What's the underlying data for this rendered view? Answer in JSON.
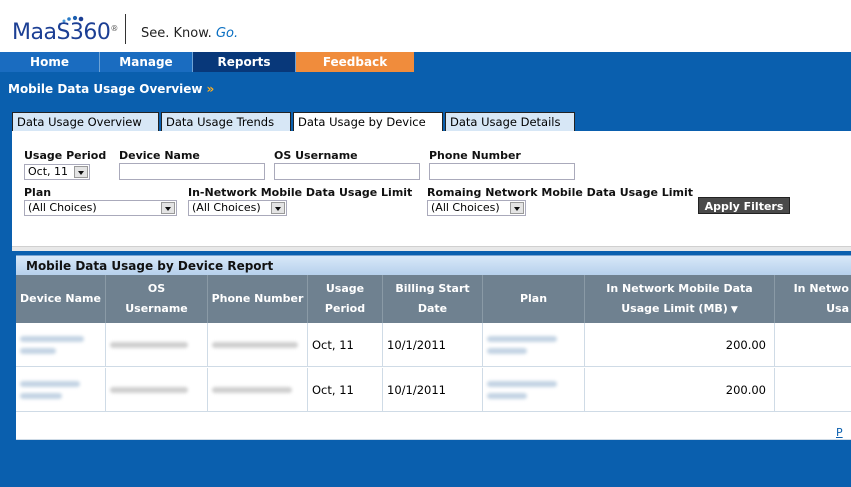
{
  "header": {
    "logo_text": "MaaS360",
    "logo_mark": "®",
    "tagline_prefix": "See. Know.",
    "tagline_go": "Go."
  },
  "nav": {
    "home": "Home",
    "manage": "Manage",
    "reports": "Reports",
    "feedback": "Feedback"
  },
  "section": {
    "title": "Mobile Data Usage Overview",
    "arrow": "»"
  },
  "tabs": [
    {
      "label": "Data Usage Overview"
    },
    {
      "label": "Data Usage Trends"
    },
    {
      "label": "Data Usage by Device"
    },
    {
      "label": "Data Usage Details"
    }
  ],
  "filters": {
    "usage_period_label": "Usage Period",
    "usage_period_value": "Oct, 11",
    "device_name_label": "Device Name",
    "device_name_value": "",
    "os_username_label": "OS Username",
    "os_username_value": "",
    "phone_number_label": "Phone Number",
    "phone_number_value": "",
    "plan_label": "Plan",
    "plan_value": "(All Choices)",
    "in_network_label": "In-Network Mobile Data Usage Limit",
    "in_network_value": "(All Choices)",
    "roaming_label": "Romaing Network Mobile Data Usage Limit",
    "roaming_value": "(All Choices)",
    "apply_label": "Apply Filters"
  },
  "report": {
    "title": "Mobile Data Usage by Device Report",
    "columns": [
      {
        "line1": "Device Name",
        "line2": ""
      },
      {
        "line1": "OS",
        "line2": "Username"
      },
      {
        "line1": "Phone Number",
        "line2": ""
      },
      {
        "line1": "Usage",
        "line2": "Period"
      },
      {
        "line1": "Billing Start",
        "line2": "Date"
      },
      {
        "line1": "Plan",
        "line2": ""
      },
      {
        "line1": "In Network Mobile Data",
        "line2": "Usage Limit (MB)"
      },
      {
        "line1": "In Netwo",
        "line2": "Usa"
      }
    ],
    "rows": [
      {
        "usage_period": "Oct, 11",
        "billing_start": "10/1/2011",
        "limit": "200.00"
      },
      {
        "usage_period": "Oct, 11",
        "billing_start": "10/1/2011",
        "limit": "200.00"
      }
    ],
    "pager": "P"
  },
  "colors": {
    "brand_blue": "#0a5fae",
    "reports_tab": "#08387a",
    "feedback_tab": "#f08c3c"
  }
}
